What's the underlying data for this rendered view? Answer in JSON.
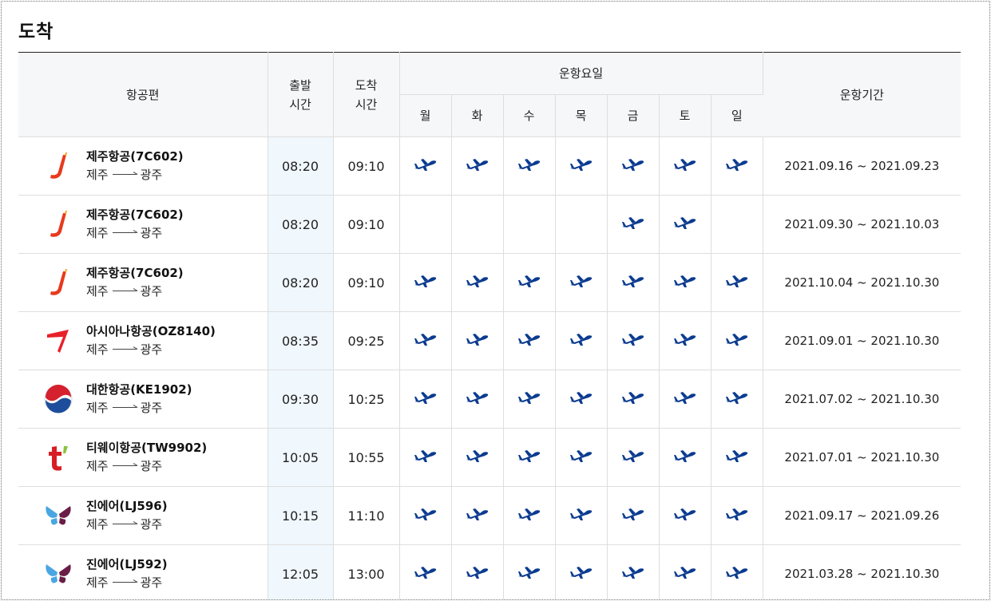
{
  "title": "도착",
  "header": {
    "flight": "항공편",
    "depart_line1": "출발",
    "depart_line2": "시간",
    "arrive_line1": "도착",
    "arrive_line2": "시간",
    "days_group": "운항요일",
    "days": [
      "월",
      "화",
      "수",
      "목",
      "금",
      "토",
      "일"
    ],
    "period": "운항기간"
  },
  "icons": {
    "plane_color": "#0b3b8f",
    "jeju_color": "#e8391d",
    "asiana_color": "#e8202a",
    "korean_red": "#d5202e",
    "korean_blue": "#1e4d9b",
    "tway_color": "#d71e25",
    "jinair_blue": "#4aa6e2",
    "jinair_purple": "#6a1e47"
  },
  "rows": [
    {
      "airline": "jeju",
      "logo_icon": "jeju-air-logo-icon",
      "name": "제주항공(7C602)",
      "from": "제주",
      "to": "광주",
      "depart": "08:20",
      "arrive": "09:10",
      "days": [
        1,
        1,
        1,
        1,
        1,
        1,
        1
      ],
      "period": "2021.09.16 ~ 2021.09.23"
    },
    {
      "airline": "jeju",
      "logo_icon": "jeju-air-logo-icon",
      "name": "제주항공(7C602)",
      "from": "제주",
      "to": "광주",
      "depart": "08:20",
      "arrive": "09:10",
      "days": [
        0,
        0,
        0,
        0,
        1,
        1,
        0
      ],
      "period": "2021.09.30 ~ 2021.10.03"
    },
    {
      "airline": "jeju",
      "logo_icon": "jeju-air-logo-icon",
      "name": "제주항공(7C602)",
      "from": "제주",
      "to": "광주",
      "depart": "08:20",
      "arrive": "09:10",
      "days": [
        1,
        1,
        1,
        1,
        1,
        1,
        1
      ],
      "period": "2021.10.04 ~ 2021.10.30"
    },
    {
      "airline": "asiana",
      "logo_icon": "asiana-logo-icon",
      "name": "아시아나항공(OZ8140)",
      "from": "제주",
      "to": "광주",
      "depart": "08:35",
      "arrive": "09:25",
      "days": [
        1,
        1,
        1,
        1,
        1,
        1,
        1
      ],
      "period": "2021.09.01 ~ 2021.10.30"
    },
    {
      "airline": "korean",
      "logo_icon": "korean-air-logo-icon",
      "name": "대한항공(KE1902)",
      "from": "제주",
      "to": "광주",
      "depart": "09:30",
      "arrive": "10:25",
      "days": [
        1,
        1,
        1,
        1,
        1,
        1,
        1
      ],
      "period": "2021.07.02 ~ 2021.10.30"
    },
    {
      "airline": "tway",
      "logo_icon": "tway-logo-icon",
      "name": "티웨이항공(TW9902)",
      "from": "제주",
      "to": "광주",
      "depart": "10:05",
      "arrive": "10:55",
      "days": [
        1,
        1,
        1,
        1,
        1,
        1,
        1
      ],
      "period": "2021.07.01 ~ 2021.10.30"
    },
    {
      "airline": "jinair",
      "logo_icon": "jinair-logo-icon",
      "name": "진에어(LJ596)",
      "from": "제주",
      "to": "광주",
      "depart": "10:15",
      "arrive": "11:10",
      "days": [
        1,
        1,
        1,
        1,
        1,
        1,
        1
      ],
      "period": "2021.09.17 ~ 2021.09.26"
    },
    {
      "airline": "jinair",
      "logo_icon": "jinair-logo-icon",
      "name": "진에어(LJ592)",
      "from": "제주",
      "to": "광주",
      "depart": "12:05",
      "arrive": "13:00",
      "days": [
        1,
        1,
        1,
        1,
        1,
        1,
        1
      ],
      "period": "2021.03.28 ~ 2021.10.30"
    }
  ]
}
